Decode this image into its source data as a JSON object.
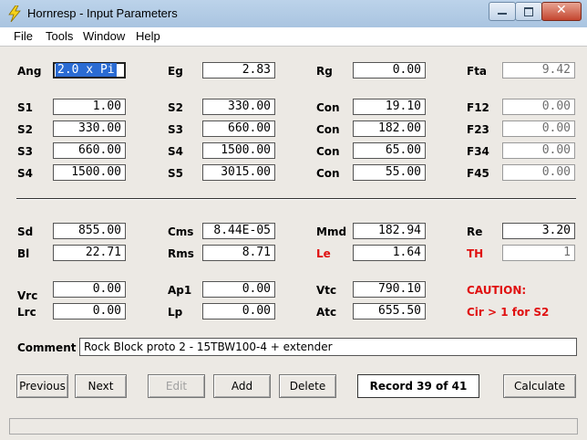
{
  "window": {
    "title": "Hornresp - Input Parameters"
  },
  "menu": [
    "File",
    "Tools",
    "Window",
    "Help"
  ],
  "params": {
    "ang": {
      "label": "Ang",
      "value": "2.0 x Pi"
    },
    "eg": {
      "label": "Eg",
      "value": "2.83"
    },
    "rg": {
      "label": "Rg",
      "value": "0.00"
    },
    "fta": {
      "label": "Fta",
      "value": "9.42"
    },
    "s1": {
      "label": "S1",
      "value": "1.00"
    },
    "s2a": {
      "label": "S2",
      "value": "330.00"
    },
    "con1": {
      "label": "Con",
      "value": "19.10"
    },
    "f12": {
      "label": "F12",
      "value": "0.00"
    },
    "s2b": {
      "label": "S2",
      "value": "330.00"
    },
    "s3a": {
      "label": "S3",
      "value": "660.00"
    },
    "con2": {
      "label": "Con",
      "value": "182.00"
    },
    "f23": {
      "label": "F23",
      "value": "0.00"
    },
    "s3b": {
      "label": "S3",
      "value": "660.00"
    },
    "s4a": {
      "label": "S4",
      "value": "1500.00"
    },
    "con3": {
      "label": "Con",
      "value": "65.00"
    },
    "f34": {
      "label": "F34",
      "value": "0.00"
    },
    "s4b": {
      "label": "S4",
      "value": "1500.00"
    },
    "s5": {
      "label": "S5",
      "value": "3015.00"
    },
    "con4": {
      "label": "Con",
      "value": "55.00"
    },
    "f45": {
      "label": "F45",
      "value": "0.00"
    },
    "sd": {
      "label": "Sd",
      "value": "855.00"
    },
    "cms": {
      "label": "Cms",
      "value": "8.44E-05"
    },
    "mmd": {
      "label": "Mmd",
      "value": "182.94"
    },
    "re": {
      "label": "Re",
      "value": "3.20"
    },
    "bl": {
      "label": "Bl",
      "value": "22.71"
    },
    "rms": {
      "label": "Rms",
      "value": "8.71"
    },
    "le": {
      "label": "Le",
      "value": "1.64"
    },
    "th": {
      "label": "TH",
      "value": "1"
    },
    "vrc": {
      "label": "Vrc",
      "value": "0.00"
    },
    "ap1": {
      "label": "Ap1",
      "value": "0.00"
    },
    "vtc": {
      "label": "Vtc",
      "value": "790.10"
    },
    "lrc": {
      "label": "Lrc",
      "value": "0.00"
    },
    "lp": {
      "label": "Lp",
      "value": "0.00"
    },
    "atc": {
      "label": "Atc",
      "value": "655.50"
    }
  },
  "caution": {
    "title": "CAUTION:",
    "message": "Cir > 1 for S2"
  },
  "comment": {
    "label": "Comment",
    "value": "Rock Block proto 2 - 15TBW100-4 + extender"
  },
  "buttons": {
    "previous": "Previous",
    "next": "Next",
    "edit": "Edit",
    "add": "Add",
    "delete": "Delete",
    "calculate": "Calculate"
  },
  "record": "Record 39 of 41",
  "colors": {
    "accent_red": "#e01010",
    "selection": "#2a6bd3"
  }
}
